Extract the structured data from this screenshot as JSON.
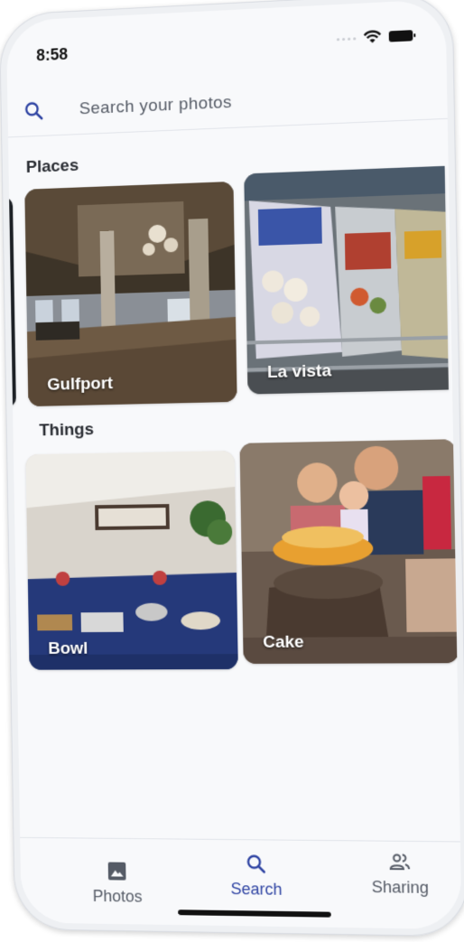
{
  "status": {
    "time": "8:58"
  },
  "search": {
    "placeholder": "Search your photos"
  },
  "sections": {
    "places": {
      "title": "Places",
      "cards": [
        {
          "label": "Gulfport"
        },
        {
          "label": "La vista"
        }
      ]
    },
    "things": {
      "title": "Things",
      "cards": [
        {
          "label": "Bowl"
        },
        {
          "label": "Cake"
        }
      ]
    }
  },
  "nav": {
    "items": [
      {
        "label": "Photos",
        "icon": "image-icon"
      },
      {
        "label": "Search",
        "icon": "search-icon"
      },
      {
        "label": "Sharing",
        "icon": "people-icon"
      }
    ],
    "active": "Search"
  },
  "colors": {
    "accent": "#2f44a3",
    "muted": "#555b66",
    "background": "#f8f9fb"
  }
}
